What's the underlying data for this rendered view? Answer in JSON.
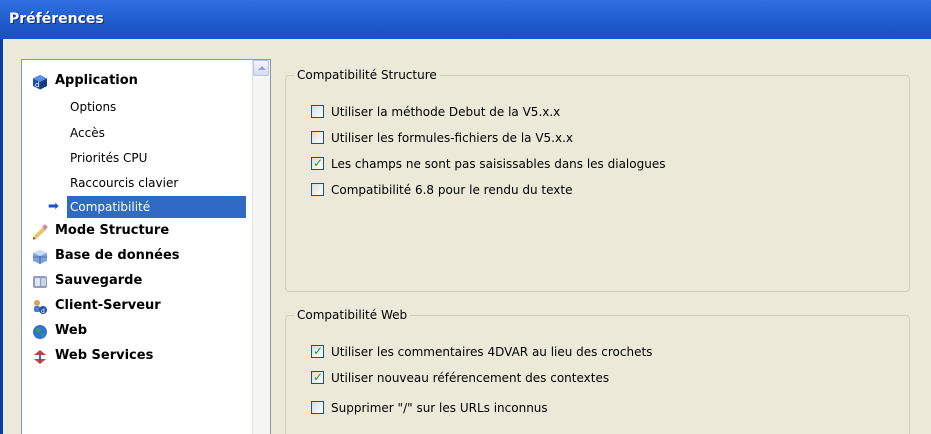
{
  "window": {
    "title": "Préférences"
  },
  "tree": {
    "application": {
      "label": "Application",
      "icon": "application-cube-icon",
      "children": [
        {
          "label": "Options"
        },
        {
          "label": "Accès"
        },
        {
          "label": "Priorités CPU"
        },
        {
          "label": "Raccourcis clavier"
        },
        {
          "label": "Compatibilité",
          "selected": true
        }
      ]
    },
    "mode_structure": {
      "label": "Mode Structure",
      "icon": "pencil-icon"
    },
    "base_donnees": {
      "label": "Base de données",
      "icon": "database-icon"
    },
    "sauvegarde": {
      "label": "Sauvegarde",
      "icon": "backup-icon"
    },
    "client_serveur": {
      "label": "Client-Serveur",
      "icon": "client-server-icon"
    },
    "web": {
      "label": "Web",
      "icon": "globe-icon"
    },
    "web_services": {
      "label": "Web Services",
      "icon": "web-services-icon"
    }
  },
  "compat_structure": {
    "title": "Compatibilité Structure",
    "options": [
      {
        "label": "Utiliser la méthode Debut de la V5.x.x",
        "checked": false
      },
      {
        "label": "Utiliser les formules-fichiers de la V5.x.x",
        "checked": false
      },
      {
        "label": "Les champs ne sont pas saisissables dans les dialogues",
        "checked": true
      },
      {
        "label": "Compatibilité 6.8 pour le rendu du texte",
        "checked": false
      }
    ]
  },
  "compat_web": {
    "title": "Compatibilité Web",
    "options": [
      {
        "label": "Utiliser les commentaires 4DVAR au lieu des crochets",
        "checked": true
      },
      {
        "label": "Utiliser nouveau référencement des contextes",
        "checked": true
      },
      {
        "label": "Supprimer \"/\" sur les URLs inconnus",
        "checked": false
      }
    ]
  },
  "colors": {
    "title_bar": "#2766d6",
    "selection": "#316ac5",
    "dialog_bg": "#ece9d8"
  }
}
